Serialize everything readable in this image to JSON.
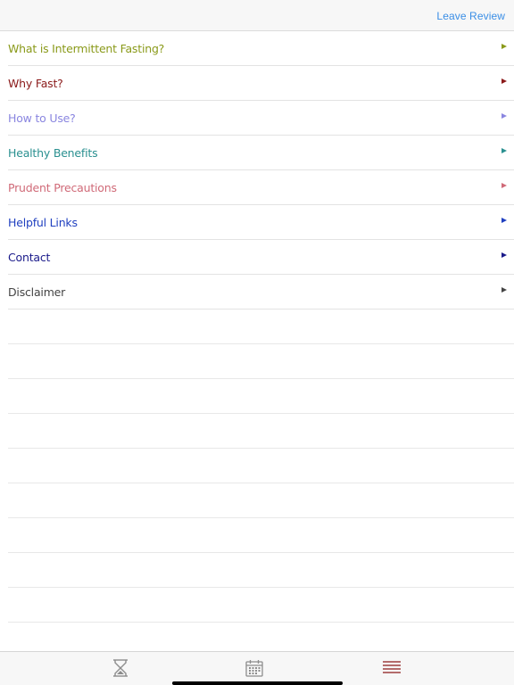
{
  "nav": {
    "leave_review": "Leave Review"
  },
  "menu": [
    {
      "label": "What is Intermittent Fasting?",
      "color": "#8a9a1a"
    },
    {
      "label": "Why Fast?",
      "color": "#8b1a1a"
    },
    {
      "label": "How to Use?",
      "color": "#8a86e0"
    },
    {
      "label": "Healthy Benefits",
      "color": "#2a9090"
    },
    {
      "label": "Prudent Precautions",
      "color": "#d06a78"
    },
    {
      "label": "Helpful Links",
      "color": "#2040c0"
    },
    {
      "label": "Contact",
      "color": "#1a1a8a"
    },
    {
      "label": "Disclaimer",
      "color": "#444444"
    }
  ],
  "tab_bar": {
    "tabs": [
      {
        "icon": "hourglass-icon",
        "color": "#8c8c8c"
      },
      {
        "icon": "calendar-icon",
        "color": "#8c8c8c"
      },
      {
        "icon": "menu-lines-icon",
        "color": "#8b1a1a",
        "selected": true
      }
    ]
  }
}
